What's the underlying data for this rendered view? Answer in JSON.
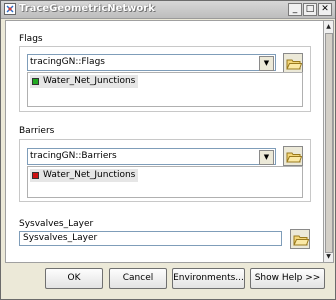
{
  "window": {
    "title": "TraceGeometricNetwork",
    "controls": {
      "minimize": "_",
      "maximize": "□",
      "close": "✕"
    }
  },
  "flags": {
    "label": "Flags",
    "selected": "tracingGN::Flags",
    "items": [
      {
        "label": "Water_Net_Junctions",
        "color": "#22aa22"
      }
    ]
  },
  "barriers": {
    "label": "Barriers",
    "selected": "tracingGN::Barriers",
    "items": [
      {
        "label": "Water_Net_Junctions",
        "color": "#cc1111"
      }
    ]
  },
  "sysvalves": {
    "label": "Sysvalves_Layer",
    "value": "Sysvalves_Layer"
  },
  "buttons": {
    "ok": "OK",
    "cancel": "Cancel",
    "environments": "Environments...",
    "show_help": "Show Help >>"
  },
  "icons": {
    "app": "network-tool-icon",
    "browse": "open-folder-icon",
    "dropdown": "chevron-down-icon"
  }
}
